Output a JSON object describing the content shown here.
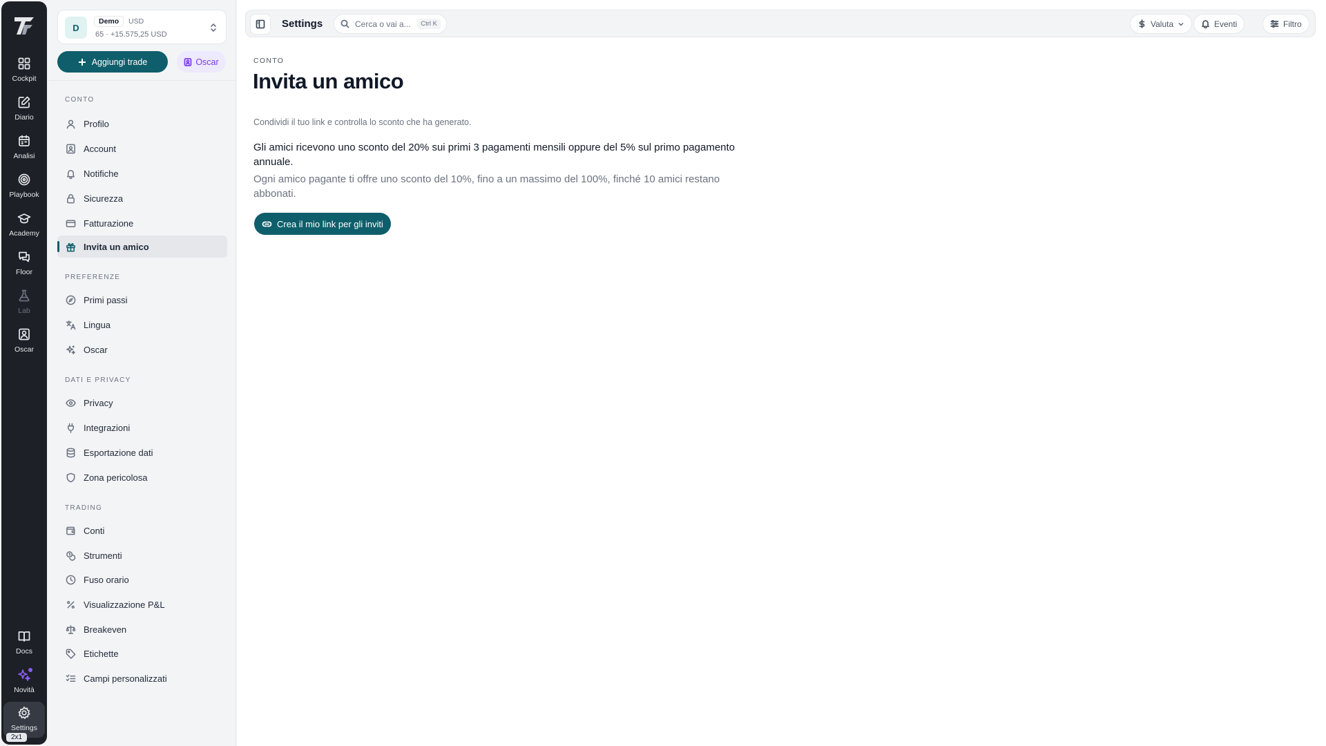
{
  "rail": {
    "items": [
      {
        "label": "Cockpit",
        "icon": "grid-icon"
      },
      {
        "label": "Diario",
        "icon": "edit-icon"
      },
      {
        "label": "Analisi",
        "icon": "calendar-icon"
      },
      {
        "label": "Playbook",
        "icon": "target-icon"
      },
      {
        "label": "Academy",
        "icon": "graduation-cap-icon"
      },
      {
        "label": "Floor",
        "icon": "chat-icon"
      },
      {
        "label": "Lab",
        "icon": "flask-icon"
      },
      {
        "label": "Oscar",
        "icon": "person-frame-icon"
      }
    ],
    "bottom": [
      {
        "label": "Docs",
        "icon": "book-icon"
      },
      {
        "label": "Novità",
        "icon": "sparkles-icon"
      },
      {
        "label": "Settings",
        "icon": "gear-icon"
      }
    ],
    "badge": "2x1"
  },
  "account": {
    "avatar": "D",
    "tag": "Demo",
    "currency": "USD",
    "line": "65 · +15.575,25 USD"
  },
  "actions": {
    "add_trade": "Aggiungi trade",
    "oscar": "Oscar"
  },
  "sidebar": {
    "sections": {
      "conto": "CONTO",
      "preferenze": "PREFERENZE",
      "dati": "DATI E PRIVACY",
      "trading": "TRADING"
    },
    "conto": [
      "Profilo",
      "Account",
      "Notifiche",
      "Sicurezza",
      "Fatturazione",
      "Invita un amico"
    ],
    "preferenze": [
      "Primi passi",
      "Lingua",
      "Oscar"
    ],
    "dati": [
      "Privacy",
      "Integrazioni",
      "Esportazione dati",
      "Zona pericolosa"
    ],
    "trading": [
      "Conti",
      "Strumenti",
      "Fuso orario",
      "Visualizzazione P&L",
      "Breakeven",
      "Etichette",
      "Campi personalizzati"
    ]
  },
  "topbar": {
    "title": "Settings",
    "search_placeholder": "Cerca o vai a...",
    "shortcut": "Ctrl K",
    "valuta": "Valuta",
    "eventi": "Eventi",
    "filtro": "Filtro"
  },
  "page": {
    "crumb": "CONTO",
    "title": "Invita un amico",
    "subtitle": "Condividi il tuo link e controlla lo sconto che ha generato.",
    "p1": "Gli amici ricevono uno sconto del 20% sui primi 3 pagamenti mensili oppure del 5% sul primo pagamento annuale.",
    "p2": "Ogni amico pagante ti offre uno sconto del 10%, fino a un massimo del 100%, finché 10 amici restano abbonati.",
    "cta": "Crea il mio link per gli inviti"
  },
  "colors": {
    "accent": "#0f5e6b",
    "purple": "#7c3aed",
    "rail": "#1d2026"
  }
}
